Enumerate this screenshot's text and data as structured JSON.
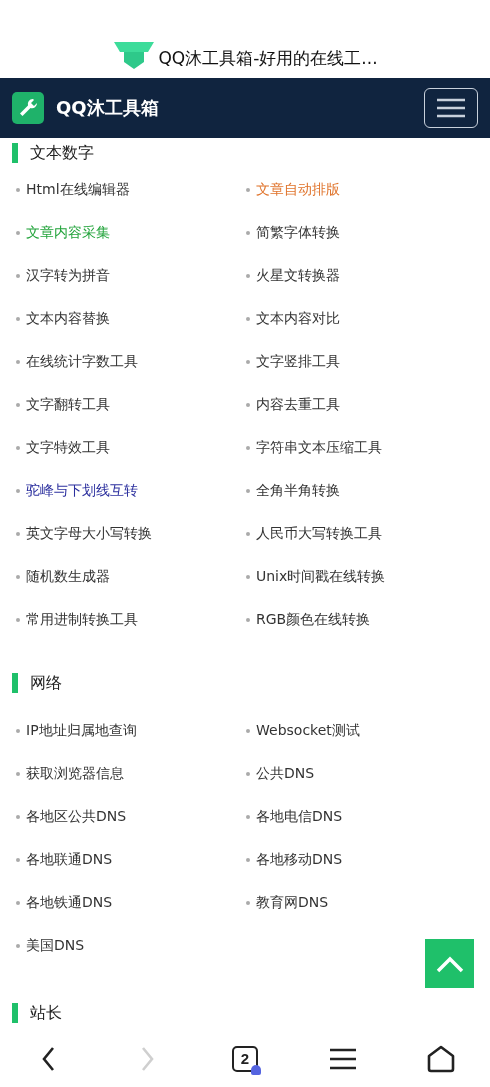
{
  "browser_tab": {
    "title": "QQ沐工具箱-好用的在线工..."
  },
  "navbar": {
    "brand": "QQ沐工具箱"
  },
  "sections": [
    {
      "heading": "文本数字",
      "items": [
        {
          "label": "Html在线编辑器"
        },
        {
          "label": "文章自动排版",
          "color": "#e0742c"
        },
        {
          "label": "文章内容采集",
          "color": "#21a33a"
        },
        {
          "label": "简繁字体转换"
        },
        {
          "label": "汉字转为拼音"
        },
        {
          "label": "火星文转换器"
        },
        {
          "label": "文本内容替换"
        },
        {
          "label": "文本内容对比"
        },
        {
          "label": "在线统计字数工具"
        },
        {
          "label": "文字竖排工具"
        },
        {
          "label": "文字翻转工具"
        },
        {
          "label": "内容去重工具"
        },
        {
          "label": "文字特效工具"
        },
        {
          "label": "字符串文本压缩工具"
        },
        {
          "label": "驼峰与下划线互转",
          "color": "#2b2f9e"
        },
        {
          "label": "全角半角转换"
        },
        {
          "label": "英文字母大小写转换"
        },
        {
          "label": "人民币大写转换工具"
        },
        {
          "label": "随机数生成器"
        },
        {
          "label": "Unix时间戳在线转换"
        },
        {
          "label": "常用进制转换工具"
        },
        {
          "label": "RGB颜色在线转换"
        }
      ]
    },
    {
      "heading": "网络",
      "items": [
        {
          "label": "IP地址归属地查询"
        },
        {
          "label": "Websocket测试"
        },
        {
          "label": "获取浏览器信息"
        },
        {
          "label": "公共DNS"
        },
        {
          "label": "各地区公共DNS"
        },
        {
          "label": "各地电信DNS"
        },
        {
          "label": "各地联通DNS"
        },
        {
          "label": "各地移动DNS"
        },
        {
          "label": "各地铁通DNS"
        },
        {
          "label": "教育网DNS"
        },
        {
          "label": "美国DNS"
        }
      ]
    },
    {
      "heading": "站长"
    }
  ],
  "bottom_bar": {
    "tab_count": "2",
    "forward_disabled": true
  }
}
